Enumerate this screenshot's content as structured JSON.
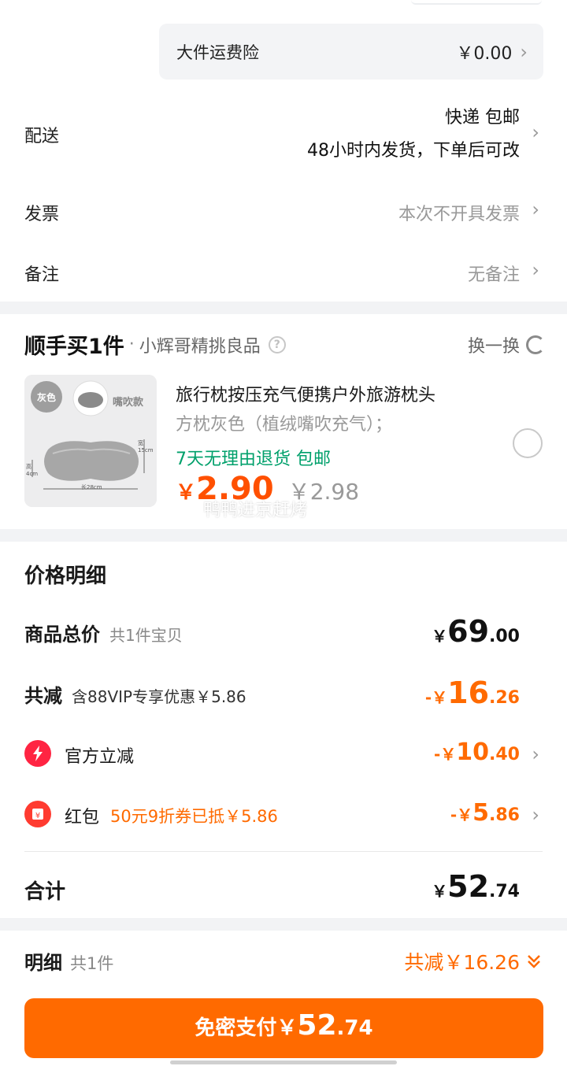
{
  "freight": {
    "label": "大件运费险",
    "value": "￥0.00"
  },
  "delivery": {
    "label": "配送",
    "line1": "快递 包邮",
    "line2": "48小时内发货，下单后可改"
  },
  "invoice": {
    "label": "发票",
    "value": "本次不开具发票"
  },
  "remark": {
    "label": "备注",
    "value": "无备注"
  },
  "bundle": {
    "brand": "顺手买1件",
    "shop": "小辉哥精挑良品",
    "swap_label": "换一换",
    "thumb_tag1": "灰色",
    "thumb_tag2": "嘴吹款",
    "thumb_dim_w": "宽15cm",
    "thumb_dim_h": "高4cm",
    "thumb_dim_l": "长28cm",
    "product_name": "旅行枕按压充气便携户外旅游枕头",
    "spec": "方枕灰色（植绒嘴吹充气）；",
    "tags": "7天无理由退货  包邮",
    "price_currency": "￥",
    "price": "2.90",
    "orig_price": "￥2.98",
    "watermark": "鸭鸭进京赶烤"
  },
  "price_detail": {
    "title": "价格明细",
    "total_label": "商品总价",
    "total_sub": "共1件宝贝",
    "total_s": "￥",
    "total_b": "69",
    "total_d": ".00",
    "discount_label": "共减",
    "discount_sub": "含88VIP专享优惠￥5.86",
    "discount_s": "-￥",
    "discount_b": "16",
    "discount_d": ".26",
    "official_label": "官方立减",
    "official_s": "-￥",
    "official_b": "10",
    "official_d": ".40",
    "redpack_label": "红包",
    "redpack_note": "50元9折券已抵￥5.86",
    "redpack_s": "-￥",
    "redpack_b": "5",
    "redpack_d": ".86",
    "sum_label": "合计",
    "sum_s": "￥",
    "sum_b": "52",
    "sum_d": ".74"
  },
  "footer": {
    "detail_label": "明细",
    "detail_count": "共1件",
    "detail_discount": "共减￥16.26",
    "pay_text": "免密支付",
    "pay_s": "￥",
    "pay_b": "52",
    "pay_d": ".74"
  },
  "colors": {
    "accent": "#ff6a00",
    "green": "#00a06b",
    "brand_orange": "#ff5000"
  }
}
